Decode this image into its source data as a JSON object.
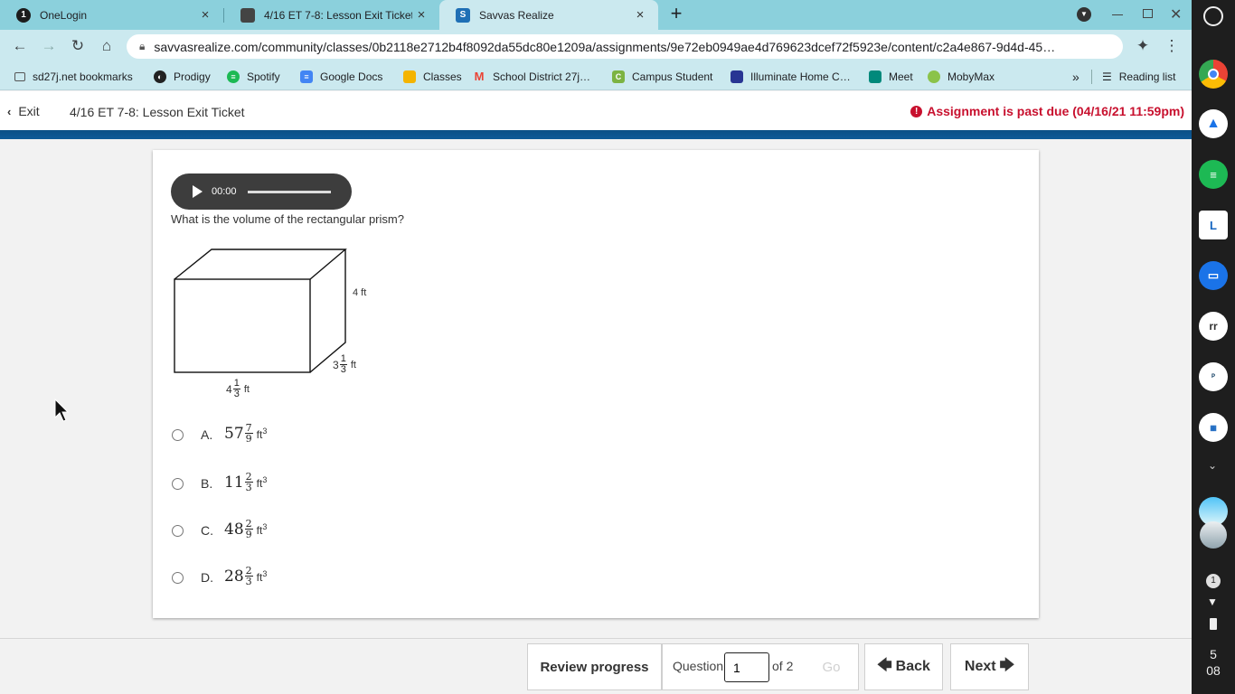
{
  "browser": {
    "tabs": [
      {
        "title": "OneLogin",
        "icon": "onelogin-icon",
        "close": "×"
      },
      {
        "title": "4/16 ET 7-8: Lesson Exit Ticket",
        "icon": "classroom-assignment-icon",
        "close": "×"
      },
      {
        "title": "Savvas Realize",
        "icon": "savvas-icon",
        "close": "×"
      }
    ],
    "new_tab": "+",
    "url": "savvasrealize.com/community/classes/0b2118e2712b4f8092da55dc80e1209a/assignments/9e72eb0949ae4d769623dcef72f5923e/content/c2a4e867-9d4d-45…",
    "bookmarks": [
      {
        "label": "sd27j.net bookmarks",
        "icon": "folder-icon"
      },
      {
        "label": "Prodigy",
        "icon": "prodigy-icon"
      },
      {
        "label": "Spotify",
        "icon": "spotify-icon"
      },
      {
        "label": "Google Docs",
        "icon": "google-docs-icon"
      },
      {
        "label": "Classes",
        "icon": "classroom-icon"
      },
      {
        "label": "School District 27j…",
        "icon": "gmail-icon"
      },
      {
        "label": "Campus Student",
        "icon": "campus-icon"
      },
      {
        "label": "Illuminate Home C…",
        "icon": "illuminate-icon"
      },
      {
        "label": "Meet",
        "icon": "meet-icon"
      },
      {
        "label": "MobyMax",
        "icon": "mobymax-icon"
      }
    ],
    "more_bookmarks": "»",
    "reading_list": "Reading list"
  },
  "header": {
    "exit_label": "Exit",
    "title": "4/16 ET 7-8: Lesson Exit Ticket",
    "past_due": "Assignment is past due (04/16/21 11:59pm)"
  },
  "audio": {
    "time": "00:00"
  },
  "question": {
    "prompt": "What is the volume of the rectangular prism?",
    "dims": {
      "height": "4 ft",
      "depth_whole": "3",
      "depth_num": "1",
      "depth_den": "3",
      "depth_unit": "ft",
      "length_whole": "4",
      "length_num": "1",
      "length_den": "3",
      "length_unit": "ft"
    },
    "options": [
      {
        "letter": "A.",
        "whole": "57",
        "num": "7",
        "den": "9",
        "unit": "ft",
        "exp": "3"
      },
      {
        "letter": "B.",
        "whole": "11",
        "num": "2",
        "den": "3",
        "unit": "ft",
        "exp": "3"
      },
      {
        "letter": "C.",
        "whole": "48",
        "num": "2",
        "den": "9",
        "unit": "ft",
        "exp": "3"
      },
      {
        "letter": "D.",
        "whole": "28",
        "num": "2",
        "den": "3",
        "unit": "ft",
        "exp": "3"
      }
    ]
  },
  "footer": {
    "review": "Review progress",
    "question_label": "Question",
    "question_value": "1",
    "of_total": "of 2",
    "go": "Go",
    "back": "Back",
    "next": "Next"
  },
  "shelf": {
    "notifications": "1",
    "time_hour": "5",
    "time_min": "08"
  },
  "colors": {
    "tabstrip": "#8bd0dc",
    "toolbar": "#cbe9ef",
    "brand_blue": "#0e5a97",
    "past_due_red": "#c8102e"
  }
}
